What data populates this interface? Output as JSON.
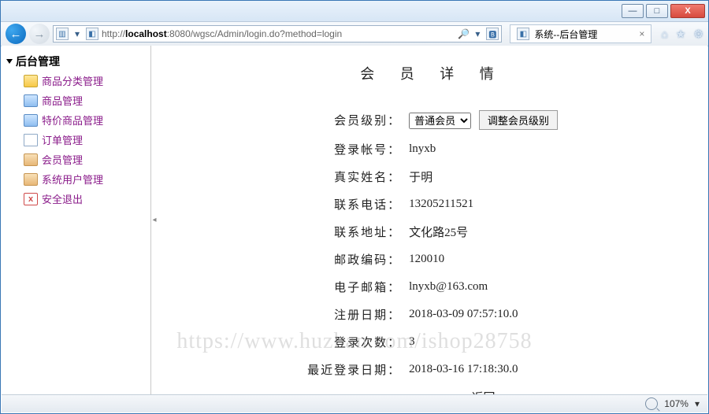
{
  "window": {
    "min": "—",
    "max": "□",
    "close": "X"
  },
  "browser": {
    "url_host": "localhost",
    "url_rest": ":8080/wgsc/Admin/login.do?method=login",
    "url_prefix": "http://",
    "search_icon": "🔎",
    "refresh_icon": "⟳",
    "dropdown_icon": "▾",
    "x_icon": "×",
    "bing_icon": "🅱",
    "tab_title": "系统--后台管理",
    "tab_close": "×",
    "home_icon": "⌂",
    "star_icon": "★",
    "gear_icon": "⚙"
  },
  "sidebar": {
    "root": "后台管理",
    "items": [
      {
        "label": "商品分类管理"
      },
      {
        "label": "商品管理"
      },
      {
        "label": "特价商品管理"
      },
      {
        "label": "订单管理"
      },
      {
        "label": "会员管理"
      },
      {
        "label": "系统用户管理"
      },
      {
        "label": "安全退出"
      }
    ]
  },
  "splitter_icon": "◂",
  "page": {
    "title": "会 员 详 情",
    "labels": {
      "level": "会员级别：",
      "account": "登录帐号：",
      "realname": "真实姓名：",
      "phone": "联系电话：",
      "address": "联系地址：",
      "postcode": "邮政编码：",
      "email": "电子邮箱：",
      "regdate": "注册日期：",
      "logins": "登录次数：",
      "lastlogin": "最近登录日期："
    },
    "values": {
      "level_option": "普通会员",
      "adjust_btn": "调整会员级别",
      "account": "lnyxb",
      "realname": "于明",
      "phone": "13205211521",
      "address": "文化路25号",
      "postcode": "120010",
      "email": "lnyxb@163.com",
      "regdate": "2018-03-09 07:57:10.0",
      "logins": "3",
      "lastlogin": "2018-03-16 17:18:30.0"
    },
    "back": "返回"
  },
  "watermark": "https://www.huzhan.com/ishop28758",
  "status": {
    "zoom": "107%",
    "arrow": "▾"
  }
}
